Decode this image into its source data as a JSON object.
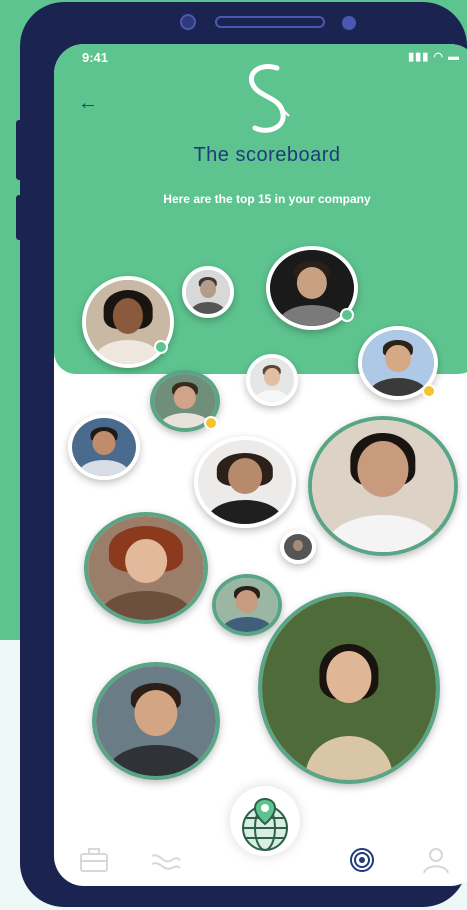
{
  "status": {
    "time": "9:41",
    "icons": "▮▮▮ ◠ ▬"
  },
  "header": {
    "back_icon": "←",
    "title": "The scoreboard",
    "subtitle": "Here are the top 15 in your company"
  },
  "colors": {
    "brand_green": "#5ec48f",
    "navy": "#1f3b7a",
    "phone_frame": "#1b2450",
    "online": "#5ec48f",
    "away": "#f4c430"
  },
  "avatars": [
    {
      "name": "user-1",
      "status": "online"
    },
    {
      "name": "user-2",
      "status": "none"
    },
    {
      "name": "user-3",
      "status": "online"
    },
    {
      "name": "user-4",
      "status": "away"
    },
    {
      "name": "user-5",
      "status": "none"
    },
    {
      "name": "user-6",
      "status": "away"
    },
    {
      "name": "user-7",
      "status": "none"
    },
    {
      "name": "user-8",
      "status": "none"
    },
    {
      "name": "user-9",
      "status": "none"
    },
    {
      "name": "user-10",
      "status": "none"
    },
    {
      "name": "user-11",
      "status": "none"
    },
    {
      "name": "user-12",
      "status": "none"
    },
    {
      "name": "user-13",
      "status": "none"
    },
    {
      "name": "user-14",
      "status": "none"
    },
    {
      "name": "user-15",
      "status": "none"
    }
  ],
  "nav": {
    "items": [
      {
        "icon": "briefcase-icon"
      },
      {
        "icon": "activity-icon"
      },
      {
        "icon": "globe-pin-icon"
      },
      {
        "icon": "target-icon"
      },
      {
        "icon": "profile-icon"
      }
    ]
  }
}
